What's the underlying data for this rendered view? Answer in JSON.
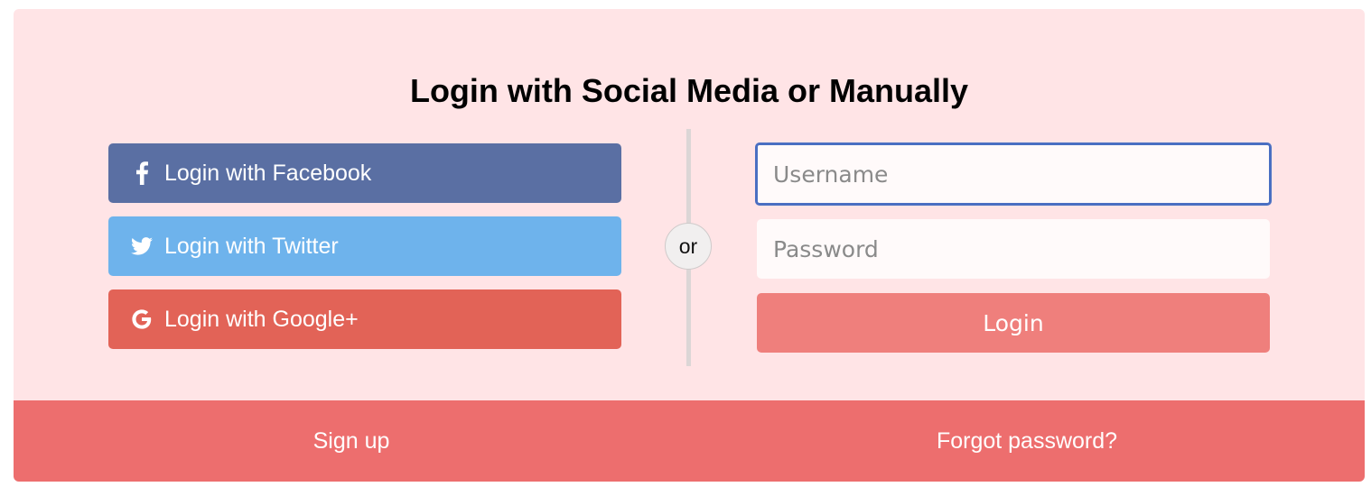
{
  "heading": "Login with Social Media or Manually",
  "social": {
    "facebook": {
      "label": "Login with Facebook",
      "icon": "facebook-icon",
      "color": "#5a6fa3"
    },
    "twitter": {
      "label": "Login with Twitter",
      "icon": "twitter-icon",
      "color": "#6eb3ec"
    },
    "google": {
      "label": "Login with Google+",
      "icon": "google-icon",
      "color": "#e26357"
    }
  },
  "separator": "or",
  "form": {
    "username_placeholder": "Username",
    "username_value": "",
    "password_placeholder": "Password",
    "password_value": "",
    "submit_label": "Login",
    "submit_color": "#ef7f7c"
  },
  "footer": {
    "signup_label": "Sign up",
    "forgot_label": "Forgot password?",
    "color": "#ed6e6e"
  },
  "colors": {
    "card_background": "#ffe4e6",
    "focus_border": "#4a6fc2"
  }
}
